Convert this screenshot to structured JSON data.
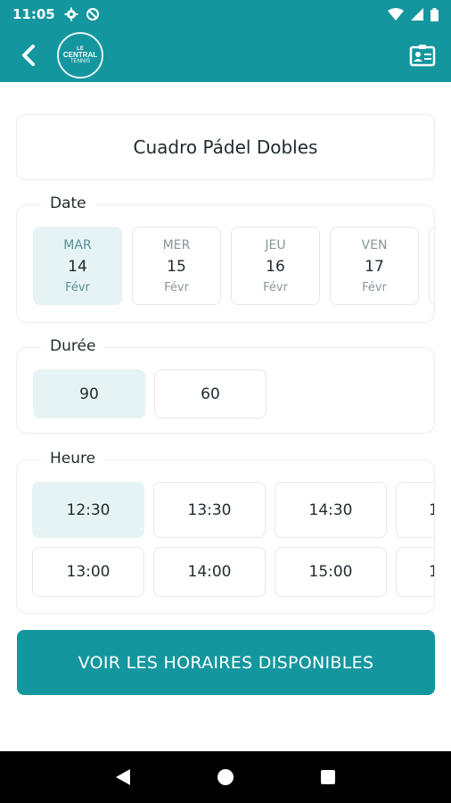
{
  "status_bar": {
    "time": "11:05"
  },
  "app_bar": {
    "logo_line1": "LE",
    "logo_line2": "CENTRAL",
    "logo_line3": "TENNIS"
  },
  "title": "Cuadro Pádel Dobles",
  "date_section": {
    "label": "Date",
    "days": [
      {
        "name": "MAR",
        "day": "14",
        "month": "Févr",
        "selected": true
      },
      {
        "name": "MER",
        "day": "15",
        "month": "Févr",
        "selected": false
      },
      {
        "name": "JEU",
        "day": "16",
        "month": "Févr",
        "selected": false
      },
      {
        "name": "VEN",
        "day": "17",
        "month": "Févr",
        "selected": false
      }
    ]
  },
  "duration_section": {
    "label": "Durée",
    "options": [
      {
        "value": "90",
        "selected": true
      },
      {
        "value": "60",
        "selected": false
      }
    ]
  },
  "time_section": {
    "label": "Heure",
    "row1": [
      "12:30",
      "13:30",
      "14:30",
      "1"
    ],
    "row2": [
      "13:00",
      "14:00",
      "15:00",
      "1"
    ],
    "selected": "12:30"
  },
  "cta": {
    "label": "VOIR LES HORAIRES DISPONIBLES"
  },
  "colors": {
    "primary": "#14969f",
    "selected_bg": "#e5f3f4"
  },
  "icons": {
    "back": "chevron-left-icon",
    "profile": "id-card-icon"
  }
}
